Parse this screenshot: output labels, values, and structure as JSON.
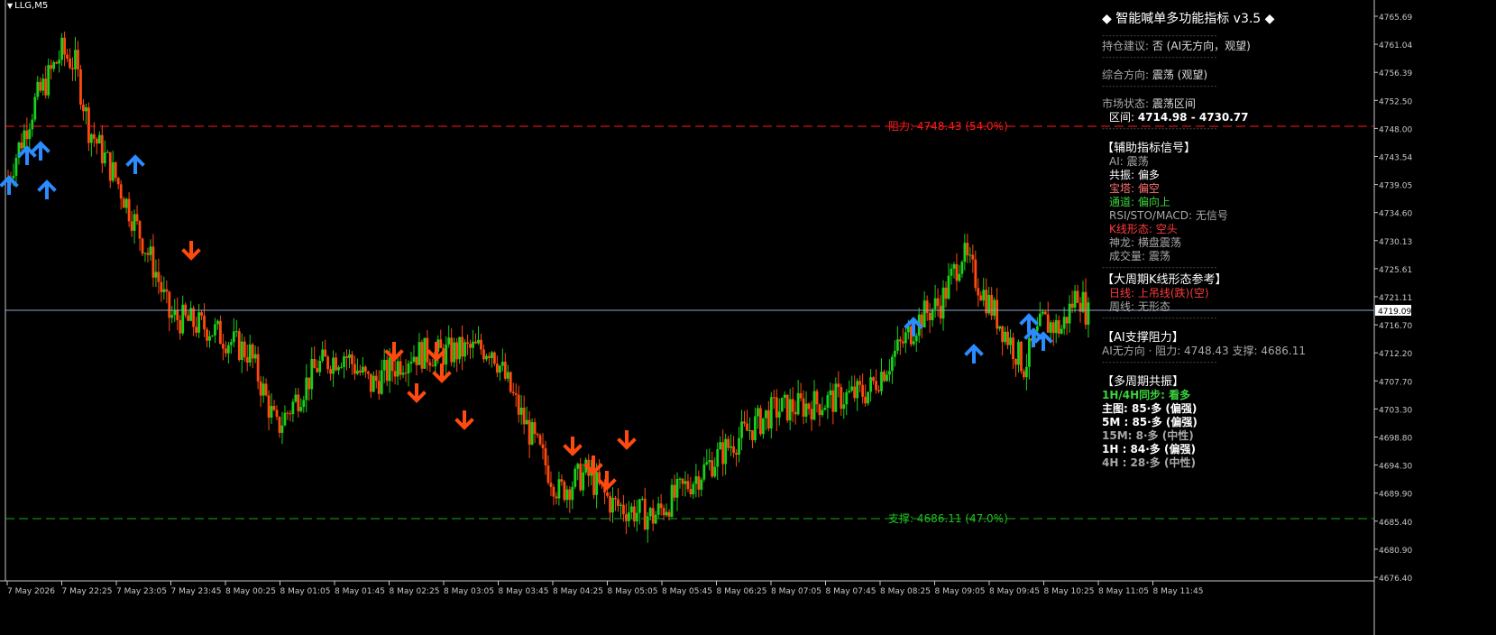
{
  "symbol": "LLG,M5",
  "colors": {
    "background": "#000000",
    "bull_candle": "#17d11a",
    "bear_candle": "#ff4a0f",
    "up_arrow": "#2b8bff",
    "down_arrow": "#ff4a0f",
    "resistance_line": "#ff1a1a",
    "support_line": "#1aa81a",
    "current_price_line": "#8ea6c8",
    "axis_text": "#c8c8c8"
  },
  "price_axis": {
    "labels": [
      "4765.69",
      "4761.04",
      "4756.39",
      "4752.50",
      "4748.00",
      "4743.54",
      "4739.05",
      "4734.60",
      "4730.13",
      "4725.61",
      "4721.11",
      "4716.70",
      "4712.20",
      "4707.70",
      "4703.30",
      "4698.80",
      "4694.30",
      "4689.90",
      "4685.40",
      "4680.90",
      "4676.40"
    ],
    "current_price": "4719.09"
  },
  "time_axis": {
    "labels": [
      "7 May 2026",
      "7 May 22:25",
      "7 May 23:05",
      "7 May 23:45",
      "8 May 00:25",
      "8 May 01:05",
      "8 May 01:45",
      "8 May 02:25",
      "8 May 03:05",
      "8 May 03:45",
      "8 May 04:25",
      "8 May 05:05",
      "8 May 05:45",
      "8 May 06:25",
      "8 May 07:05",
      "8 May 07:45",
      "8 May 08:25",
      "8 May 09:05",
      "8 May 09:45",
      "8 May 10:25",
      "8 May 11:05",
      "8 May 11:45"
    ]
  },
  "lines": {
    "resistance_label": "阻力: 4748.43 (54.0%)",
    "support_label": "支撑: 4686.11 (47.0%)"
  },
  "panel": {
    "title": "◆ 智能喊单多功能指标 v3.5 ◆",
    "hold_label": "持仓建议: ",
    "hold_value": "否 (AI无方向，观望)",
    "dir_label": "综合方向: ",
    "dir_value": "震荡 (观望)",
    "market_label": "市场状态: ",
    "market_value": "震荡区间",
    "range_label": "区间: ",
    "range_value": "4714.98 - 4730.77",
    "aux_header": "【辅助指标信号】",
    "aux": [
      {
        "k": "AI: ",
        "v": "震荡",
        "cls": "grey"
      },
      {
        "k": "共振: ",
        "v": "偏多",
        "cls": "white"
      },
      {
        "k": "宝塔: ",
        "v": "偏空",
        "cls": "pink"
      },
      {
        "k": "通道: ",
        "v": "偏向上",
        "cls": "green"
      },
      {
        "k": "RSI/STO/MACD: ",
        "v": "无信号",
        "cls": "grey"
      },
      {
        "k": "K线形态: ",
        "v": "空头",
        "cls": "red"
      },
      {
        "k": "神龙: ",
        "v": "横盘震荡",
        "cls": "grey"
      },
      {
        "k": "成交量: ",
        "v": "震荡",
        "cls": "grey"
      }
    ],
    "bigk_header": "【大周期K线形态参考】",
    "bigk": [
      {
        "k": "日线: ",
        "v": "上吊线(跌)(空)",
        "cls": "red"
      },
      {
        "k": "周线: ",
        "v": "无形态",
        "cls": "grey"
      }
    ],
    "ai_header": "【AI支撑阻力】",
    "ai_line": "AI无方向 · 阻力: 4748.43   支撑: 4686.11",
    "multi_header": "【多周期共振】",
    "multi": [
      {
        "t": "1H/4H同步: 看多",
        "cls": "green"
      },
      {
        "t": "主图: 85·多 (偏强)",
        "cls": "white"
      },
      {
        "t": "5M : 85·多 (偏强)",
        "cls": "white"
      },
      {
        "t": "15M: 8·多 (中性)",
        "cls": "grey"
      },
      {
        "t": "1H : 84·多 (偏强)",
        "cls": "white"
      },
      {
        "t": "4H : 28·多 (中性)",
        "cls": "grey"
      }
    ]
  }
}
